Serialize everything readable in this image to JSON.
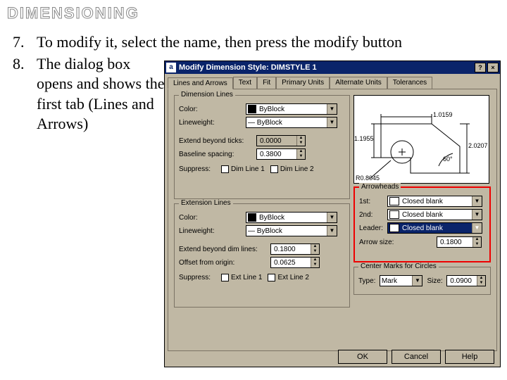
{
  "page_title": "DIMENSIONING",
  "list": [
    {
      "num": "7.",
      "text": "To modify it, select the name, then press the modify button"
    },
    {
      "num": "8.",
      "text": "The dialog box opens and shows the first tab (Lines and Arrows)"
    }
  ],
  "dialog": {
    "app_icon_char": "a",
    "title": "Modify Dimension Style: DIMSTYLE 1",
    "help_btn": "?",
    "close_btn": "×",
    "tabs": [
      "Lines and Arrows",
      "Text",
      "Fit",
      "Primary Units",
      "Alternate Units",
      "Tolerances"
    ],
    "active_tab_index": 0,
    "dim_lines": {
      "legend": "Dimension Lines",
      "color_label": "Color:",
      "color_value": "ByBlock",
      "lw_label": "Lineweight:",
      "lw_value": "— ByBlock",
      "ext_ticks_label": "Extend beyond ticks:",
      "ext_ticks_value": "0.0000",
      "baseline_label": "Baseline spacing:",
      "baseline_value": "0.3800",
      "suppress_label": "Suppress:",
      "chk1": "Dim Line 1",
      "chk2": "Dim Line 2"
    },
    "ext_lines": {
      "legend": "Extension Lines",
      "color_label": "Color:",
      "color_value": "ByBlock",
      "lw_label": "Lineweight:",
      "lw_value": "— ByBlock",
      "ext_beyond_label": "Extend beyond dim lines:",
      "ext_beyond_value": "0.1800",
      "offset_label": "Offset from origin:",
      "offset_value": "0.0625",
      "suppress_label": "Suppress:",
      "chk1": "Ext Line 1",
      "chk2": "Ext Line 2"
    },
    "preview": {
      "d1": "1.0159",
      "d2": "1.1955",
      "d3": "2.0207",
      "ang": "60°",
      "rad": "R0.8045"
    },
    "arrowheads": {
      "legend": "Arrowheads",
      "first_label": "1st:",
      "first_value": "Closed blank",
      "second_label": "2nd:",
      "second_value": "Closed blank",
      "leader_label": "Leader:",
      "leader_value": "Closed blank",
      "size_label": "Arrow size:",
      "size_value": "0.1800"
    },
    "center_marks": {
      "legend": "Center Marks for Circles",
      "type_label": "Type:",
      "type_value": "Mark",
      "size_label": "Size:",
      "size_value": "0.0900"
    },
    "buttons": {
      "ok": "OK",
      "cancel": "Cancel",
      "help": "Help"
    }
  }
}
